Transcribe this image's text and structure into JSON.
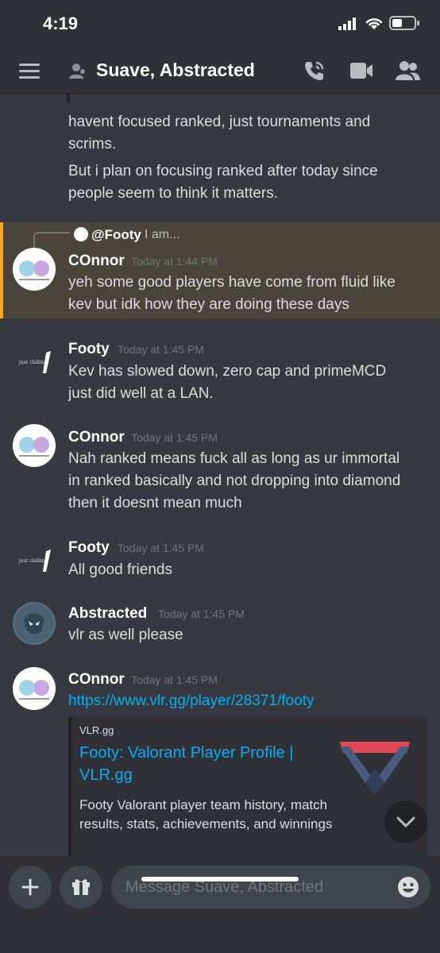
{
  "status_bar": {
    "time": "4:19"
  },
  "header": {
    "title": "Suave, Abstracted"
  },
  "composer": {
    "placeholder": "Message Suave, Abstracted"
  },
  "messages": [
    {
      "lines": [
        "havent focused ranked, just tournaments and",
        "scrims.",
        "But i plan on focusing ranked after today since",
        "people seem to think it matters."
      ]
    },
    {
      "reply_author": "@Footy",
      "reply_text": "I am...",
      "author": "COnnor",
      "timestamp": "Today at 1:44 PM",
      "lines": [
        "yeh some good players have come from fluid like",
        "kev but idk how they are doing these days"
      ]
    },
    {
      "author": "Footy",
      "timestamp": "Today at 1:45 PM",
      "lines": [
        "Kev has slowed down, zero cap and primeMCD",
        "just did well at a LAN."
      ]
    },
    {
      "author": "COnnor",
      "timestamp": "Today at 1:45 PM",
      "lines": [
        "Nah ranked means fuck all as long as ur immortal",
        "in ranked basically and not dropping into diamond",
        "then it doesnt mean much"
      ]
    },
    {
      "author": "Footy",
      "timestamp": "Today at 1:45 PM",
      "lines": [
        "All good friends"
      ]
    },
    {
      "author": "Abstracted",
      "timestamp": "Today at 1:45 PM",
      "lines": [
        "vlr as well please"
      ]
    },
    {
      "author": "COnnor",
      "timestamp": "Today at 1:45 PM",
      "link": "https://www.vlr.gg/player/28371/footy"
    }
  ],
  "embed": {
    "provider": "VLR.gg",
    "title": "Footy: Valorant Player Profile | VLR.gg",
    "description": "Footy Valorant player team history, match results, stats, achievements, and winnings"
  },
  "colors": {
    "background": "#36393f",
    "header": "#2f3136",
    "mention_highlight": "#49443c",
    "mention_bar": "#faa81a",
    "link": "#00aff4"
  }
}
